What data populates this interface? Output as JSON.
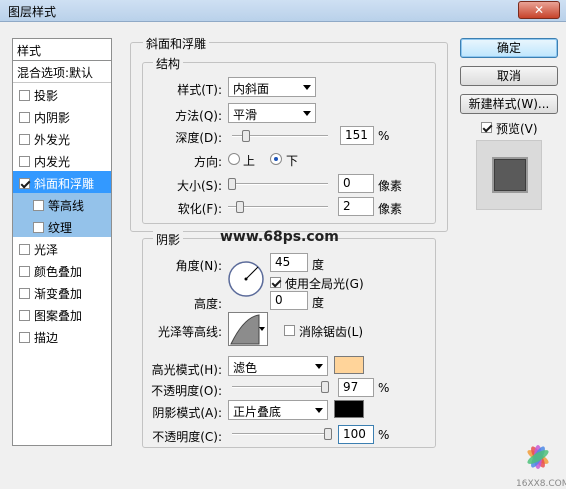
{
  "window": {
    "title": "图层样式",
    "close_label": "✕"
  },
  "list": {
    "header": "样式",
    "blend": "混合选项:默认",
    "items": [
      {
        "label": "投影",
        "checked": false,
        "type": "normal"
      },
      {
        "label": "内阴影",
        "checked": false,
        "type": "normal"
      },
      {
        "label": "外发光",
        "checked": false,
        "type": "normal"
      },
      {
        "label": "内发光",
        "checked": false,
        "type": "normal"
      },
      {
        "label": "斜面和浮雕",
        "checked": true,
        "type": "selected"
      },
      {
        "label": "等高线",
        "checked": false,
        "type": "sub"
      },
      {
        "label": "纹理",
        "checked": false,
        "type": "sub"
      },
      {
        "label": "光泽",
        "checked": false,
        "type": "normal"
      },
      {
        "label": "颜色叠加",
        "checked": false,
        "type": "normal"
      },
      {
        "label": "渐变叠加",
        "checked": false,
        "type": "normal"
      },
      {
        "label": "图案叠加",
        "checked": false,
        "type": "normal"
      },
      {
        "label": "描边",
        "checked": false,
        "type": "normal"
      }
    ]
  },
  "bevel": {
    "section_title": "斜面和浮雕",
    "structure_title": "结构",
    "style_label": "样式(T):",
    "style_value": "内斜面",
    "technique_label": "方法(Q):",
    "technique_value": "平滑",
    "depth_label": "深度(D):",
    "depth_value": "151",
    "depth_unit": "%",
    "direction_label": "方向:",
    "dir_up": "上",
    "dir_down": "下",
    "size_label": "大小(S):",
    "size_value": "0",
    "size_unit": "像素",
    "soften_label": "软化(F):",
    "soften_value": "2",
    "soften_unit": "像素"
  },
  "shading": {
    "section_title": "阴影",
    "watermark": "www.68ps.com",
    "angle_label": "角度(N):",
    "angle_value": "45",
    "angle_unit": "度",
    "global_light_label": "使用全局光(G)",
    "altitude_label": "高度:",
    "altitude_value": "0",
    "altitude_unit": "度",
    "gloss_label": "光泽等高线:",
    "antialias_label": "消除锯齿(L)",
    "highlight_mode_label": "高光模式(H):",
    "highlight_mode_value": "滤色",
    "highlight_color": "#ffd49a",
    "opacity1_label": "不透明度(O):",
    "opacity1_value": "97",
    "opacity1_unit": "%",
    "shadow_mode_label": "阴影模式(A):",
    "shadow_mode_value": "正片叠底",
    "shadow_color": "#000000",
    "opacity2_label": "不透明度(C):",
    "opacity2_value": "100",
    "opacity2_unit": "%"
  },
  "buttons": {
    "ok": "确定",
    "cancel": "取消",
    "new_style": "新建样式(W)...",
    "preview": "预览(V)"
  },
  "footer": {
    "site": "16XX8.COM"
  }
}
